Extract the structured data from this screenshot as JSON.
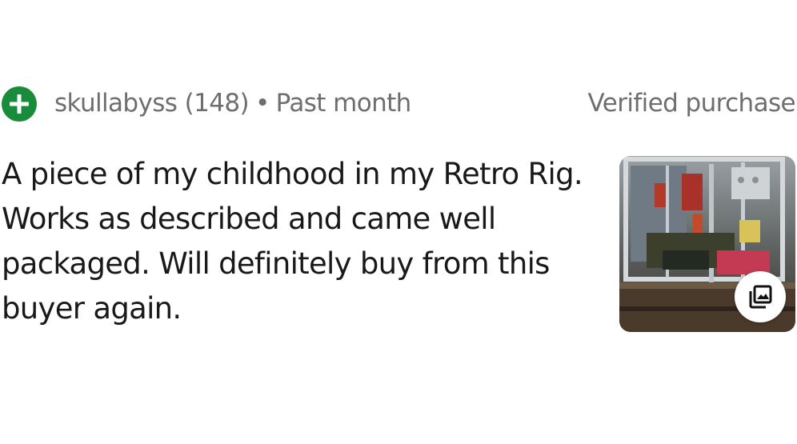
{
  "review": {
    "reviewer": "skullabyss (148)",
    "separator": "•",
    "time": "Past month",
    "verified": "Verified purchase",
    "text": "A piece of my childhood in my Retro Rig. Works as described and came well packaged. Will definitely buy from this buyer again.",
    "badge_icon": "plus-circle-icon",
    "gallery_icon": "photo-gallery-icon",
    "colors": {
      "badge": "#188c3b",
      "meta_text": "#6e6e6e",
      "body_text": "#191919"
    }
  }
}
